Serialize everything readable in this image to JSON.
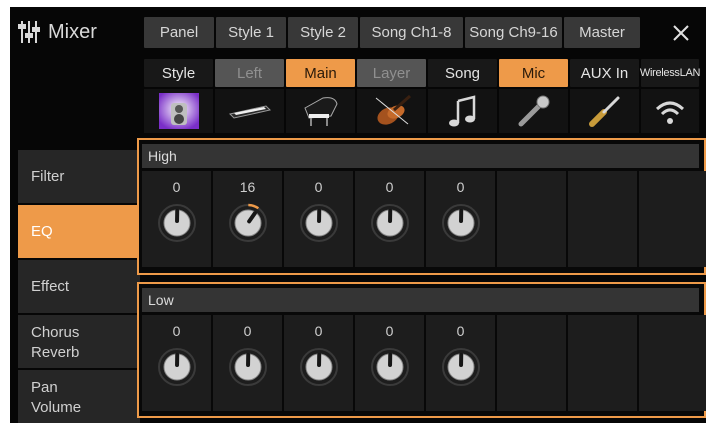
{
  "title": "Mixer",
  "top_tabs": [
    {
      "label": "Panel",
      "active": true
    },
    {
      "label": "Style 1",
      "active": false
    },
    {
      "label": "Style 2",
      "active": false
    },
    {
      "label": "Song Ch1-8",
      "active": false
    },
    {
      "label": "Song Ch9-16",
      "active": false
    },
    {
      "label": "Master",
      "active": false
    }
  ],
  "close_glyph": "✕",
  "parts": [
    {
      "label": "Style",
      "state": "normal",
      "icon": "style-speaker-icon"
    },
    {
      "label": "Left",
      "state": "dim",
      "icon": "keyboard-icon"
    },
    {
      "label": "Main",
      "state": "highlight",
      "icon": "grand-piano-icon"
    },
    {
      "label": "Layer",
      "state": "dim",
      "icon": "violin-icon"
    },
    {
      "label": "Song",
      "state": "normal",
      "icon": "music-note-icon"
    },
    {
      "label": "Mic",
      "state": "highlight",
      "icon": "microphone-icon"
    },
    {
      "label": "AUX In",
      "state": "normal",
      "icon": "aux-jack-icon"
    },
    {
      "label": "WirelessLAN",
      "state": "normal",
      "icon": "wireless-icon"
    }
  ],
  "side_menu": [
    {
      "label": "Filter",
      "active": false
    },
    {
      "label": "EQ",
      "active": true
    },
    {
      "label": "Effect",
      "active": false
    },
    {
      "label": "Chorus\nReverb",
      "active": false
    },
    {
      "label": "Pan\nVolume",
      "active": false
    }
  ],
  "eq": {
    "high": {
      "label": "High",
      "values": [
        "0",
        "16",
        "0",
        "0",
        "0"
      ],
      "knob_range": [
        -64,
        63
      ]
    },
    "low": {
      "label": "Low",
      "values": [
        "0",
        "0",
        "0",
        "0",
        "0"
      ],
      "knob_range": [
        -64,
        63
      ]
    }
  },
  "colors": {
    "accent": "#ee9a49",
    "background": "#060606",
    "tab": "#383838",
    "dim": "#555555"
  }
}
